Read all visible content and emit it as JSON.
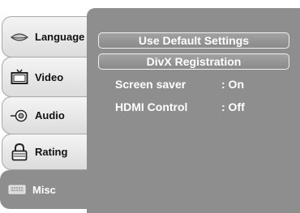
{
  "sidebar": {
    "items": [
      {
        "label": "Language",
        "icon": "speech-lips-icon"
      },
      {
        "label": "Video",
        "icon": "tv-icon"
      },
      {
        "label": "Audio",
        "icon": "speaker-icon"
      },
      {
        "label": "Rating",
        "icon": "padlock-icon"
      },
      {
        "label": "Misc",
        "icon": "keyboard-icon"
      }
    ],
    "active": "Misc"
  },
  "panel": {
    "buttons": [
      {
        "label": "Use Default Settings"
      },
      {
        "label": "DivX Registration"
      }
    ],
    "settings": [
      {
        "label": "Screen saver",
        "value": ": On"
      },
      {
        "label": "HDMI Control",
        "value": ": Off"
      }
    ]
  },
  "colors": {
    "panel": "#8e8e8e",
    "tab": "#e8e8e8",
    "text_active": "#ffffff"
  }
}
